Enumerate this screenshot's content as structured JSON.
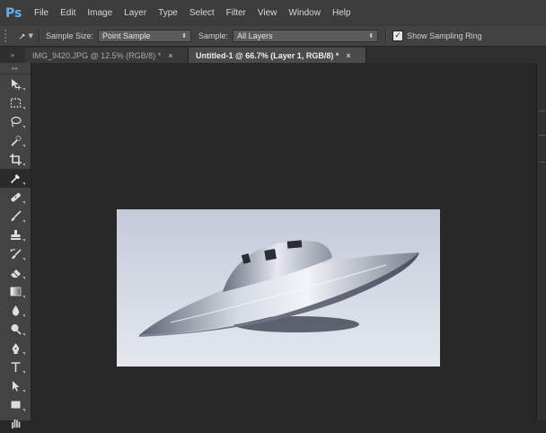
{
  "app": {
    "logo": "Ps"
  },
  "menu": [
    "File",
    "Edit",
    "Image",
    "Layer",
    "Type",
    "Select",
    "Filter",
    "View",
    "Window",
    "Help"
  ],
  "options": {
    "sample_size_label": "Sample Size:",
    "sample_size_value": "Point Sample",
    "sample_label": "Sample:",
    "sample_value": "All Layers",
    "show_ring_label": "Show Sampling Ring",
    "show_ring_checked": true
  },
  "tabs": [
    {
      "label": "IMG_9420.JPG @ 12.5% (RGB/8) *",
      "close": "×",
      "active": false
    },
    {
      "label": "Untitled-1 @ 66.7% (Layer 1, RGB/8) *",
      "close": "×",
      "active": true
    }
  ],
  "tools": [
    "move-tool",
    "marquee-tool",
    "lasso-tool",
    "quick-selection-tool",
    "crop-tool",
    "eyedropper-tool",
    "spot-healing-tool",
    "brush-tool",
    "clone-stamp-tool",
    "history-brush-tool",
    "eraser-tool",
    "gradient-tool",
    "blur-tool",
    "dodge-tool",
    "pen-tool",
    "type-tool",
    "path-selection-tool",
    "rectangle-tool",
    "hand-tool"
  ],
  "active_tool": "eyedropper-tool",
  "colors": {
    "accent": "#5fb1f1",
    "canvas": "#282828",
    "panel": "#434343"
  }
}
